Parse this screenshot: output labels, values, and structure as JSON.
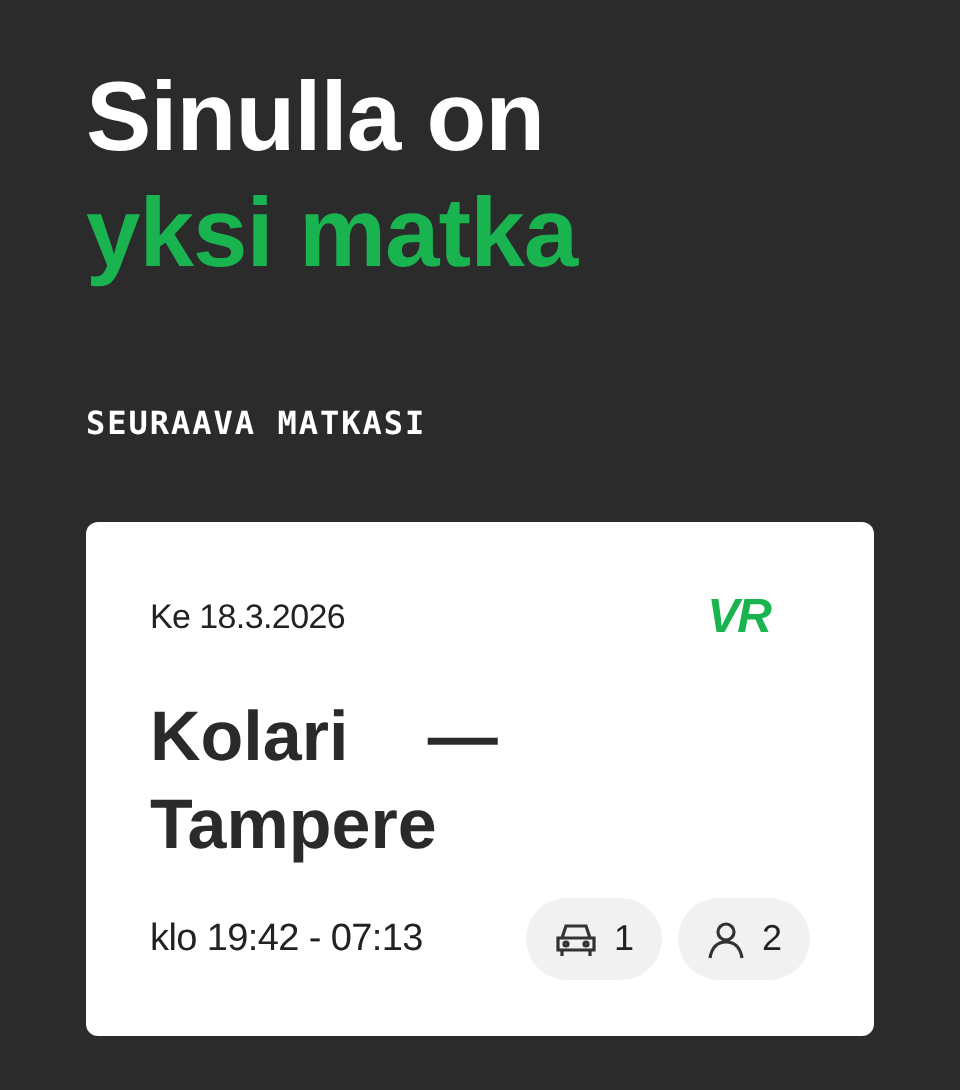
{
  "heading": {
    "line_1": "Sinulla on",
    "line_2": "yksi matka"
  },
  "section_title": "SEURAAVA MATKASI",
  "trip": {
    "date": "Ke 18.3.2026",
    "logo": "VR",
    "route": "Kolari — Tampere",
    "time": "klo 19:42 - 07:13",
    "chips": [
      {
        "kind": "vehicle",
        "count": "1"
      },
      {
        "kind": "passenger",
        "count": "2"
      }
    ]
  }
}
